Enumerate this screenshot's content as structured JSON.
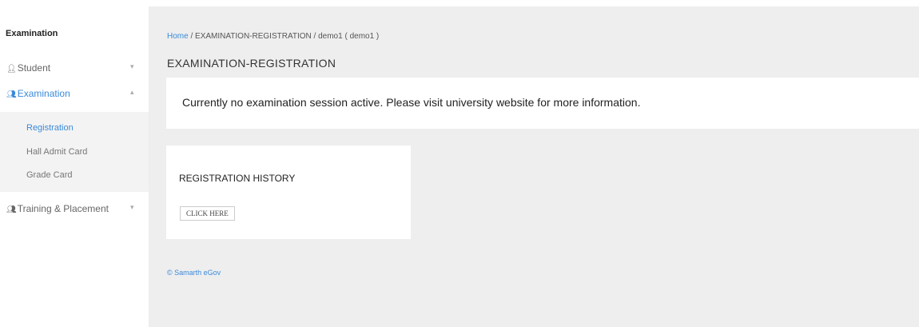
{
  "sidebar": {
    "brand": "Examination",
    "items": [
      {
        "label": "Student",
        "icon": "user-icon",
        "chevron": "▾"
      },
      {
        "label": "Examination",
        "icon": "users-icon",
        "chevron": "▴"
      },
      {
        "label": "Training & Placement",
        "icon": "users-icon",
        "chevron": "▾"
      }
    ],
    "subitems": [
      {
        "label": "Registration"
      },
      {
        "label": "Hall Admit Card"
      },
      {
        "label": "Grade Card"
      }
    ]
  },
  "breadcrumb": {
    "home": "Home",
    "rest": " / EXAMINATION-REGISTRATION / demo1 ( demo1 )"
  },
  "page": {
    "title": "EXAMINATION-REGISTRATION",
    "notice": "Currently no examination session active. Please visit university website for more information."
  },
  "history": {
    "title": "REGISTRATION HISTORY",
    "button_label": "CLICK HERE"
  },
  "footer": {
    "text": "© Samarth eGov"
  },
  "colors": {
    "accent": "#3b8ad9",
    "background": "#eeeeee"
  }
}
